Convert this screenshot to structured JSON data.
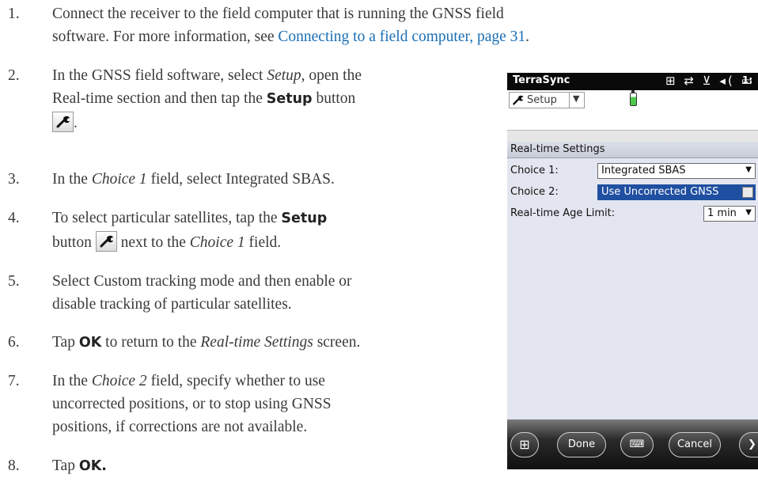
{
  "steps": [
    {
      "num": "1.",
      "lines": [
        "Connect the receiver to the field computer that is running the GNSS field",
        "software. For more information, see "
      ],
      "link": "Connecting to a field computer, page 31",
      "link_suffix": "."
    },
    {
      "num": "2.",
      "a": "In the GNSS field software, select ",
      "a_em": "Setup",
      "a_rest": ", open the",
      "b": "Real-time section and then tap the ",
      "b_bold": "Setup",
      "b_rest": " button",
      "c_rest": "."
    },
    {
      "num": "3.",
      "a": "In the ",
      "a_em": "Choice 1",
      "a_rest": " field, select Integrated SBAS."
    },
    {
      "num": "4.",
      "a": "To select particular satellites, tap the ",
      "a_bold": "Setup",
      "b": "button ",
      "b_rest": " next to the ",
      "b_em": "Choice 1",
      "b_end": " field."
    },
    {
      "num": "5.",
      "a": "Select Custom tracking mode and then enable or",
      "b": "disable tracking of particular satellites."
    },
    {
      "num": "6.",
      "a": "Tap ",
      "a_bold": "OK",
      "a_mid": " to return to the ",
      "a_em": "Real-time Settings",
      "a_end": " screen."
    },
    {
      "num": "7.",
      "a": "In the ",
      "a_em": "Choice 2",
      "a_rest": " field, specify whether to use",
      "b": "uncorrected positions, or to stop using GNSS",
      "c": "positions, if corrections are not available."
    },
    {
      "num": "8.",
      "a": "Tap ",
      "a_bold": "OK."
    }
  ],
  "device": {
    "app_title": "TerraSync",
    "status_icons": "⊞ ⇄ ⊻ ◂( ▭",
    "time": "1:",
    "menu_label": "Setup",
    "section_title": "Real-time Settings",
    "choice1_label": "Choice 1:",
    "choice1_value": "Integrated SBAS",
    "choice2_label": "Choice 2:",
    "choice2_value": "Use Uncorrected GNSS",
    "age_label": "Real-time Age Limit:",
    "age_value": "1 min",
    "softkeys": {
      "done": "Done",
      "cancel": "Cancel"
    }
  }
}
